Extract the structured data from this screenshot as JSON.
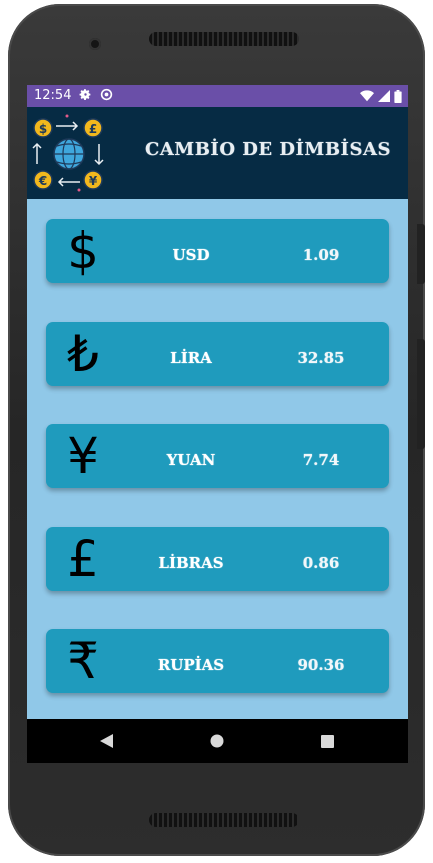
{
  "status_bar": {
    "time": "12:54",
    "left_icons": [
      "settings-gear-icon",
      "sync-icon"
    ],
    "right_icons": [
      "wifi-icon",
      "signal-icon",
      "battery-icon"
    ],
    "color": "#6a4fa8"
  },
  "header": {
    "title": "CAMBİO DE DİMBİSAS",
    "logo_icon": "currency-exchange-globe-icon",
    "background": "#062b44"
  },
  "currencies": [
    {
      "symbol": "$",
      "name": "USD",
      "value": "1.09",
      "icon": "dollar-icon"
    },
    {
      "symbol": "₺",
      "name": "LİRA",
      "value": "32.85",
      "icon": "lira-icon"
    },
    {
      "symbol": "¥",
      "name": "YUAN",
      "value": "7.74",
      "icon": "yuan-icon"
    },
    {
      "symbol": "£",
      "name": "LİBRAS",
      "value": "0.86",
      "icon": "pound-icon"
    },
    {
      "symbol": "₹",
      "name": "RUPİAS",
      "value": "90.36",
      "icon": "rupee-icon"
    }
  ],
  "nav": {
    "buttons": [
      "back-icon",
      "home-icon",
      "recents-icon"
    ]
  },
  "colors": {
    "screen_background": "#90c8e8",
    "card_background": "#1f9bbd"
  }
}
